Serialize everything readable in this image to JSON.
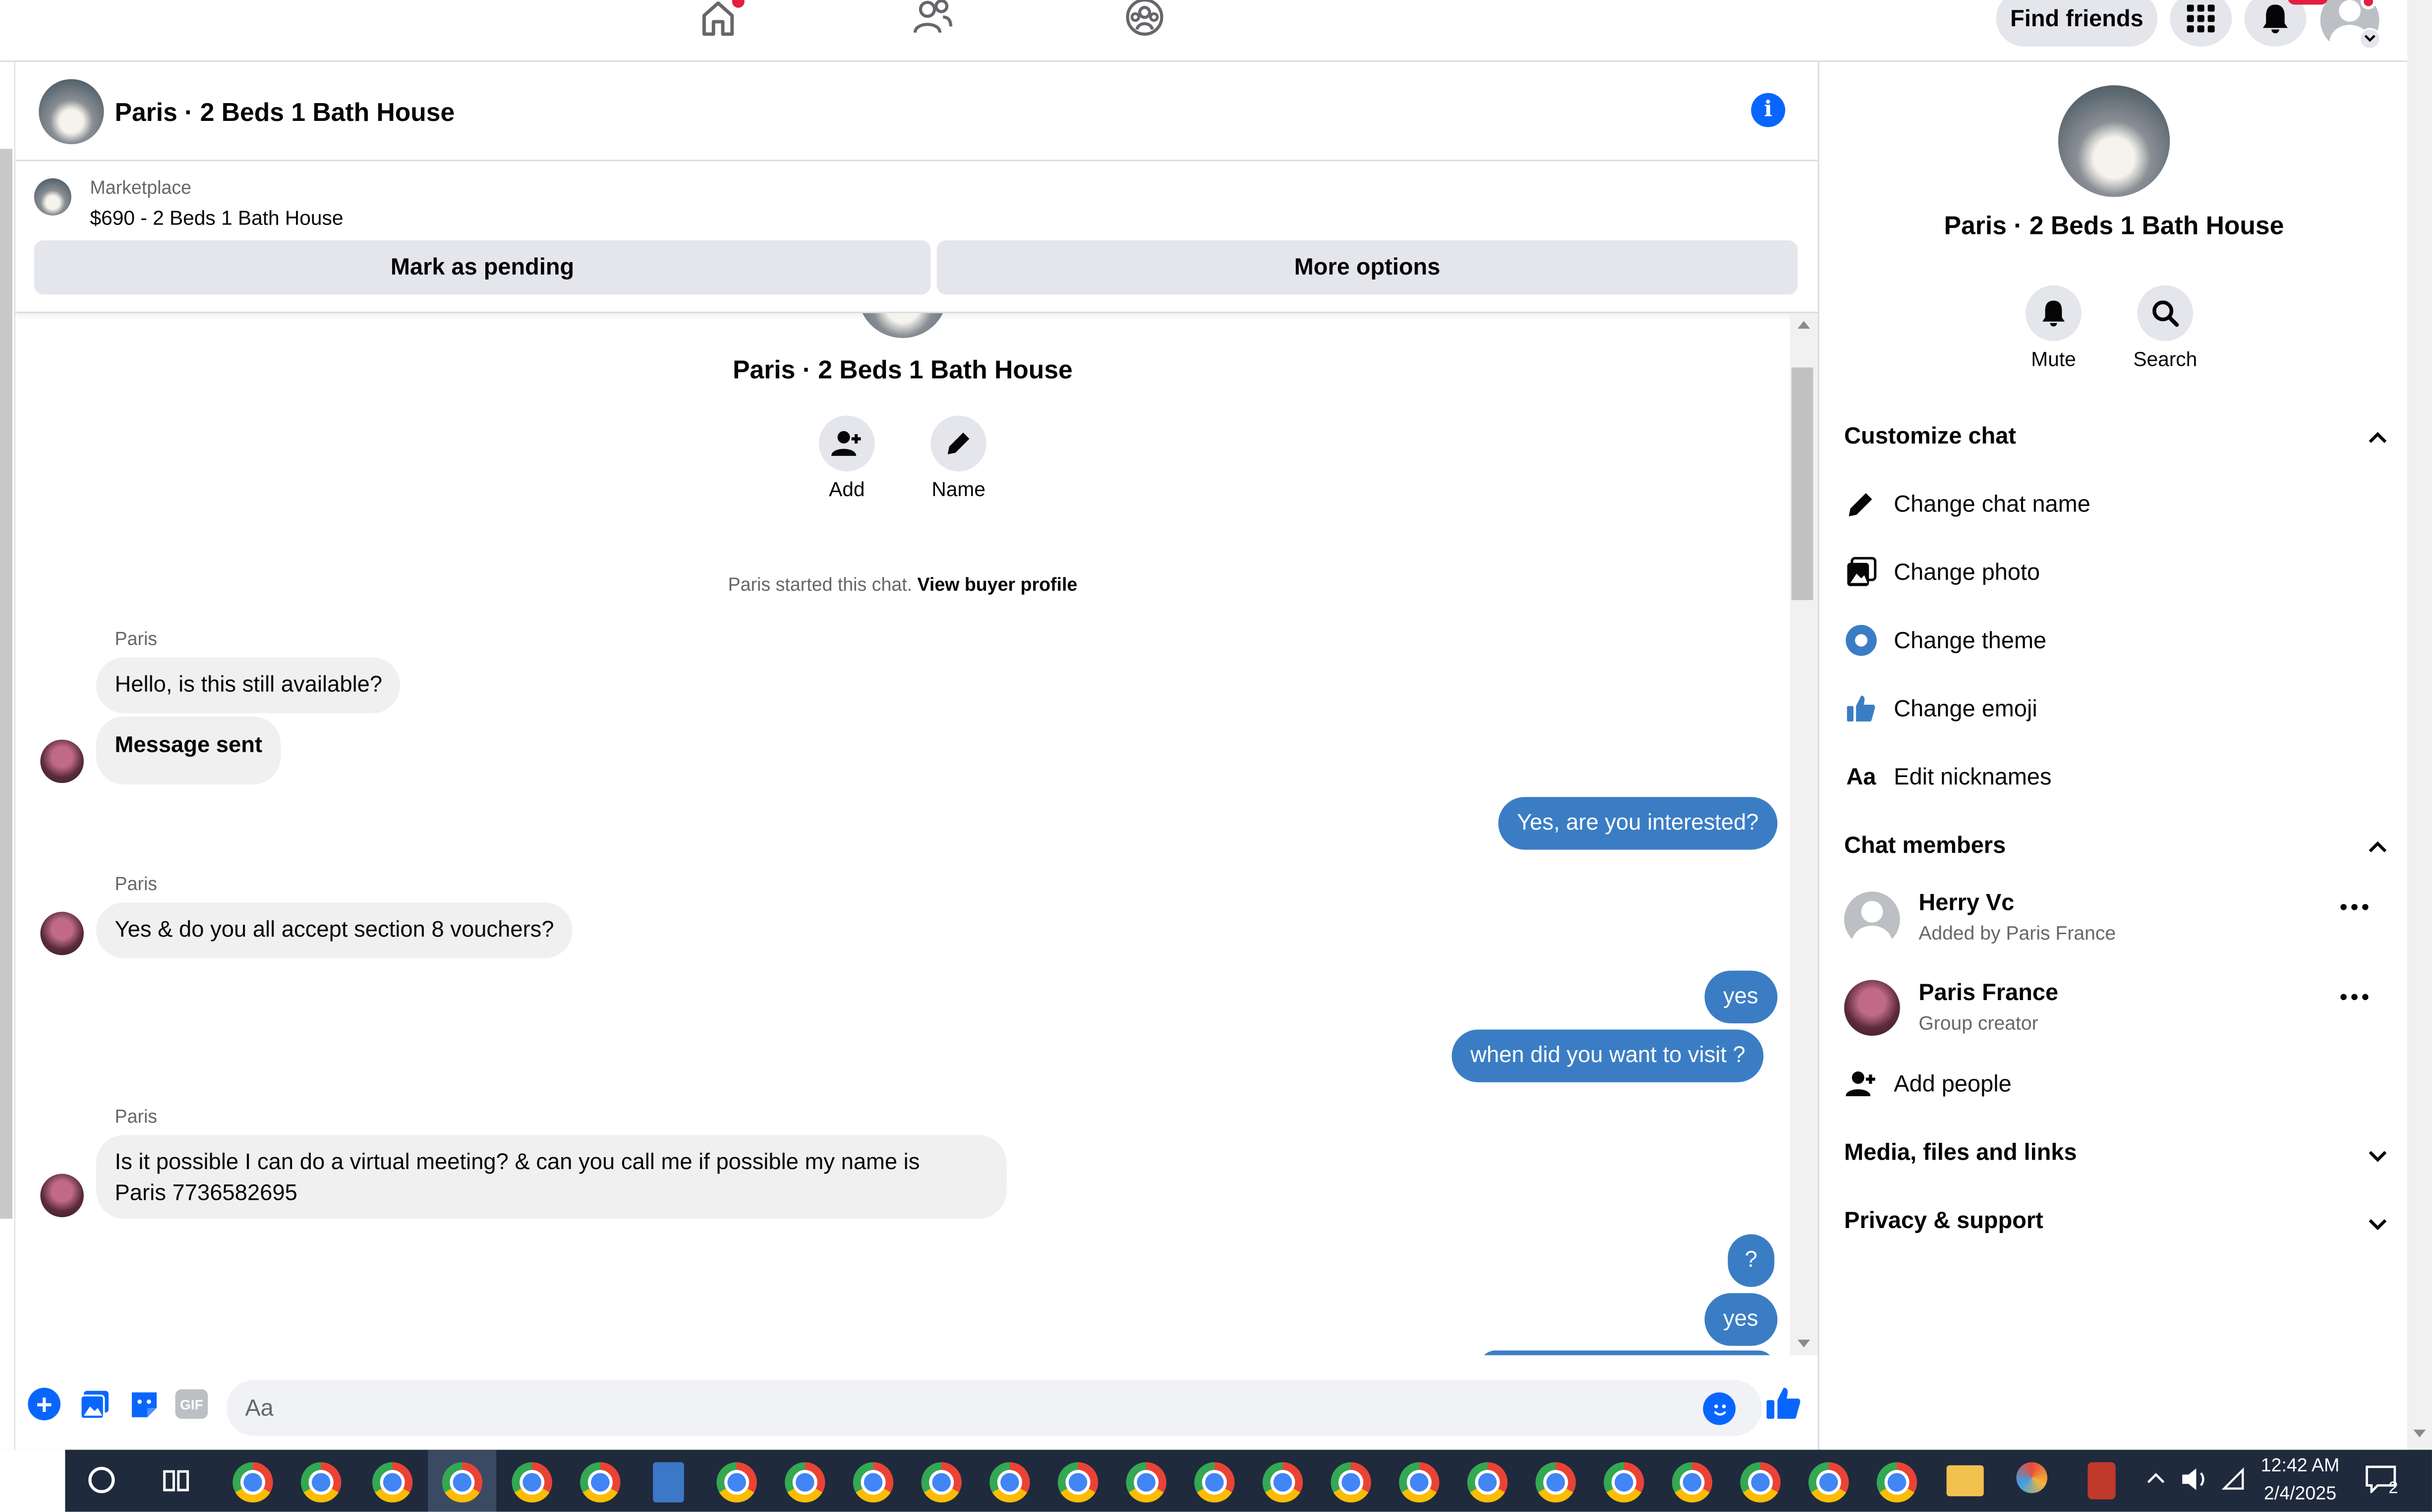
{
  "topnav": {
    "find_friends": "Find friends"
  },
  "header": {
    "title": "Paris · 2 Beds 1 Bath House"
  },
  "marketplace": {
    "label": "Marketplace",
    "listing": "$690 - 2 Beds 1 Bath House",
    "mark_pending": "Mark as pending",
    "more_options": "More options"
  },
  "intro": {
    "title": "Paris · 2 Beds 1 Bath House",
    "add": "Add",
    "name": "Name",
    "started": "Paris started this chat.",
    "view_profile": "View buyer profile"
  },
  "messages": [
    {
      "sender": "Paris",
      "text": "Hello, is this still available?"
    },
    {
      "text": "Message sent"
    },
    {
      "text": "Yes, are you interested?"
    },
    {
      "sender": "Paris",
      "text": "Yes & do you all accept section 8 vouchers?"
    },
    {
      "text": "yes"
    },
    {
      "text": "when did you want to visit ?"
    },
    {
      "sender": "Paris",
      "line1": "Is it possible I can do a virtual meeting? & can you call me if possible my name is",
      "line2": "Paris 7736582695"
    },
    {
      "text": "?"
    },
    {
      "text": "yes"
    }
  ],
  "composer": {
    "placeholder": "Aa"
  },
  "panel": {
    "title": "Paris · 2 Beds 1 Bath House",
    "mute": "Mute",
    "search": "Search",
    "customize": "Customize chat",
    "change_name": "Change chat name",
    "change_photo": "Change photo",
    "change_theme": "Change theme",
    "change_emoji": "Change emoji",
    "edit_nicknames": "Edit nicknames",
    "nick_glyph": "Aa",
    "members": "Chat members",
    "member1": {
      "name": "Herry Vc",
      "sub": "Added by Paris France"
    },
    "member2": {
      "name": "Paris France",
      "sub": "Group creator"
    },
    "add_people": "Add people",
    "media": "Media, files and links",
    "privacy": "Privacy & support"
  },
  "taskbar": {
    "time": "12:42 AM",
    "date": "2/4/2025",
    "notif_count": "2"
  },
  "colors": {
    "accent": "#0866ff",
    "bubble_me": "#3b7dc4",
    "taskbar": "#1f2a3d"
  }
}
